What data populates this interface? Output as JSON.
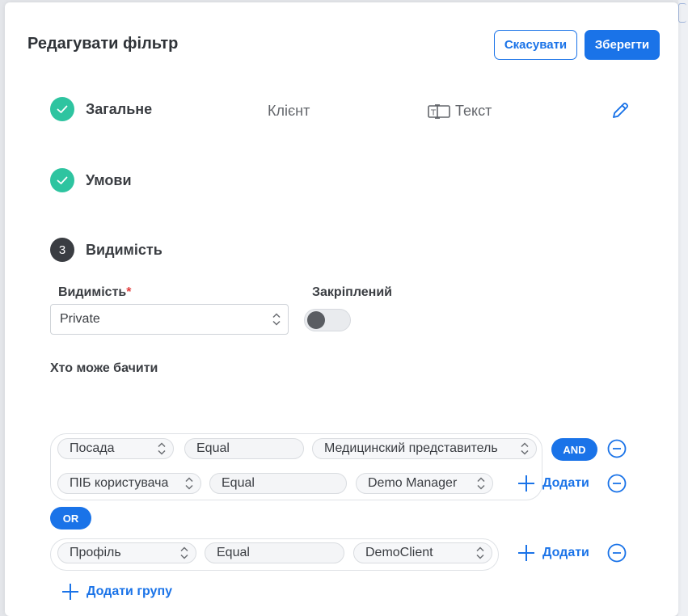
{
  "modal": {
    "title": "Редагувати фільтр",
    "cancel_label": "Скасувати",
    "save_label": "Зберегти"
  },
  "steps": [
    {
      "label": "Загальне",
      "state": "done"
    },
    {
      "label": "Умови",
      "state": "done"
    },
    {
      "label": "Видимість",
      "state": "current",
      "number": "3"
    }
  ],
  "general_summary": {
    "object": "Клієнт",
    "type": "Текст"
  },
  "visibility": {
    "label": "Видимість",
    "required_mark": "*",
    "value": "Private",
    "pinned_label": "Закріплений",
    "pinned": false,
    "who_can_see_label": "Хто може бачити"
  },
  "condition_groups": [
    {
      "rows": [
        {
          "field": "Посада",
          "operator": "Equal",
          "value": "Медицинский представитель",
          "action": "AND"
        },
        {
          "field": "ПІБ користувача",
          "operator": "Equal",
          "value": "Demo Manager",
          "action": "Додати"
        }
      ]
    },
    {
      "rows": [
        {
          "field": "Профіль",
          "operator": "Equal",
          "value": "DemoClient",
          "action": "Додати"
        }
      ]
    }
  ],
  "group_joiner": "OR",
  "add_group_label": "Додати групу",
  "colors": {
    "primary": "#1a73e8",
    "success": "#2ec4a0",
    "current_step": "#3a3d42",
    "required": "#e03c3c"
  }
}
